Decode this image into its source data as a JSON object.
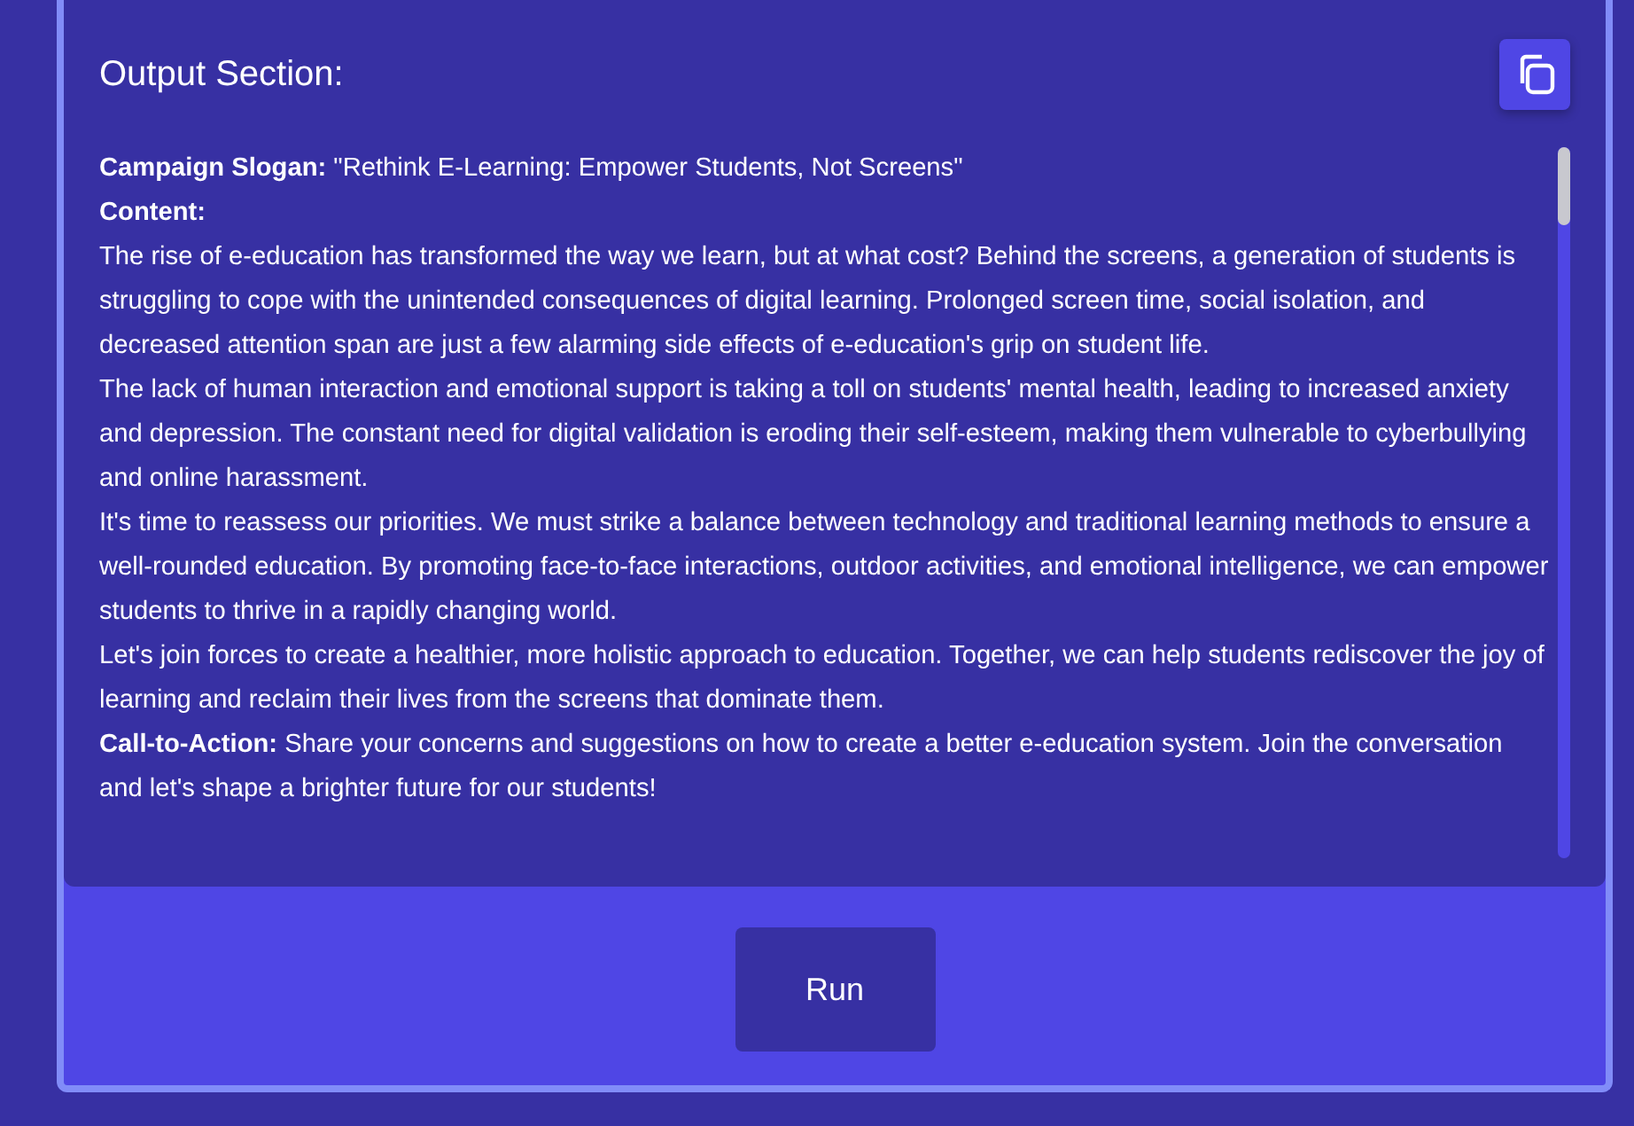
{
  "output_section": {
    "title": "Output Section:",
    "paragraphs": [
      "**Campaign Slogan:** \"Rethink E-Learning: Empower Students, Not Screens\"",
      "**Content:**",
      "The rise of e-education has transformed the way we learn, but at what cost? Behind the screens, a generation of students is struggling to cope with the unintended consequences of digital learning. Prolonged screen time, social isolation, and decreased attention span are just a few alarming side effects of e-education's grip on student life.",
      "The lack of human interaction and emotional support is taking a toll on students' mental health, leading to increased anxiety and depression. The constant need for digital validation is eroding their self-esteem, making them vulnerable to cyberbullying and online harassment.",
      "It's time to reassess our priorities. We must strike a balance between technology and traditional learning methods to ensure a well-rounded education. By promoting face-to-face interactions, outdoor activities, and emotional intelligence, we can empower students to thrive in a rapidly changing world.",
      "Let's join forces to create a healthier, more holistic approach to education. Together, we can help students rediscover the joy of learning and reclaim their lives from the screens that dominate them.",
      "**Call-to-Action:** Share your concerns and suggestions on how to create a better e-education system. Join the conversation and let's shape a brighter future for our students!"
    ]
  },
  "buttons": [
    {
      "label": "Run"
    }
  ]
}
